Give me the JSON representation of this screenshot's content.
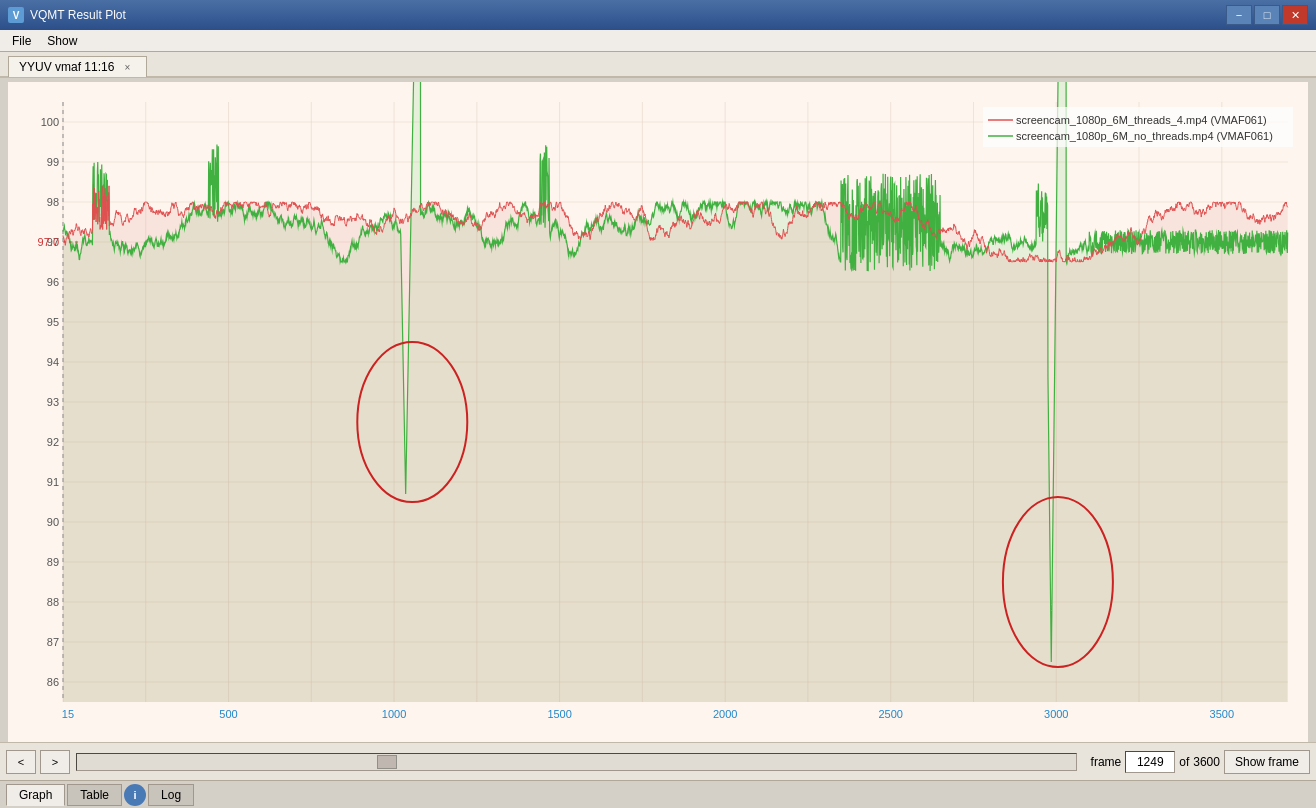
{
  "window": {
    "title": "VQMT Result Plot",
    "icon": "V"
  },
  "menu": {
    "items": [
      "File",
      "Show"
    ]
  },
  "tab": {
    "label": "YYUV vmaf 11:16",
    "close": "×"
  },
  "legend": {
    "line1": "screencam_1080p_6M_threads_4.mp4 (VMAF061)",
    "line2": "screencam_1080p_6M_no_threads.mp4 (VMAF061)",
    "color1": "#e05050",
    "color2": "#40b040"
  },
  "yaxis": {
    "label": "YYUV vmaf",
    "min": 86,
    "max": 100,
    "highlight": "97.0"
  },
  "xaxis": {
    "ticks": [
      "15",
      "500",
      "1000",
      "1500",
      "2000",
      "2500",
      "3000",
      "3500"
    ]
  },
  "controls": {
    "prev_label": "<",
    "next_label": ">",
    "frame_label": "frame",
    "frame_value": "1249",
    "total_frames": "3600",
    "of_label": "of",
    "show_frame": "Show frame"
  },
  "bottom_tabs": {
    "graph": "Graph",
    "table": "Table",
    "log": "Log",
    "info_icon": "i"
  },
  "win_controls": {
    "minimize": "−",
    "maximize": "□",
    "close": "✕"
  }
}
